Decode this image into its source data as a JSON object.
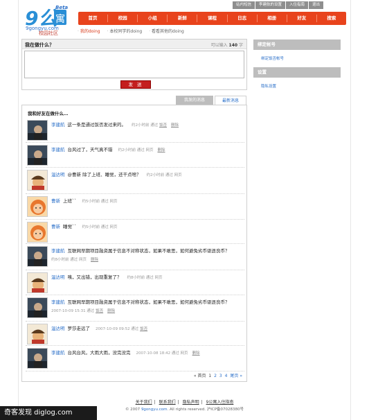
{
  "header": {
    "logo_main": "9公寓",
    "logo_beta": "Beta",
    "logo_domain": "9gongyu.com",
    "logo_sub": "校园社区",
    "top_links": [
      "站内短信",
      "李建航的设置",
      "入住指南",
      "退出"
    ],
    "nav": [
      "首页",
      "校园",
      "小组",
      "新鲜",
      "课程",
      "日志",
      "相册",
      "好友",
      "搜索"
    ],
    "subnav": [
      {
        "label": "我的doing",
        "active": true
      },
      {
        "label": "本校同学的doing",
        "active": false
      },
      {
        "label": "看看其他的doing",
        "active": false
      }
    ]
  },
  "status": {
    "title": "我在做什么？",
    "count_label": "可以输入",
    "count_value": "140",
    "count_unit": "字",
    "textarea_value": "",
    "send_label": "发 送"
  },
  "sidebar": {
    "bind_title": "绑定帐号",
    "bind_link": "绑定饭否帐号",
    "settings_title": "设置",
    "settings_link": "隐私设置"
  },
  "tabs": {
    "mine": "我发的消息",
    "latest": "最新消息"
  },
  "feed": {
    "title": "我和好友在做什么…",
    "items": [
      {
        "name": "李建航",
        "text": "这一条是通过饭否发过来的。",
        "meta": "约2小时前 通过",
        "via": "饭否",
        "del": "删除",
        "wrap": false,
        "avatar": "dark"
      },
      {
        "name": "李建航",
        "text": "台风过了，天气真不错",
        "meta": "约2小时前 通过 网页",
        "via": "",
        "del": "删除",
        "wrap": false,
        "avatar": "dark"
      },
      {
        "name": "温达明",
        "text": "@曹新  除了上班、睡觉，还干点啥？",
        "meta": "约2小时前 通过 网页",
        "via": "",
        "del": "",
        "wrap": false,
        "avatar": "hat"
      },
      {
        "name": "曹新",
        "text": "上班``",
        "meta": "约5小时前 通过 网页",
        "via": "",
        "del": "",
        "wrap": false,
        "avatar": "orange"
      },
      {
        "name": "曹新",
        "text": "睡觉``",
        "meta": "约5小时前 通过 网页",
        "via": "",
        "del": "",
        "wrap": false,
        "avatar": "orange"
      },
      {
        "name": "李建航",
        "text": "互联网早期项目融资属于信息不对称状态，如果不敢思，如何避免劣币驱逐良币？",
        "meta": "约8小时前 通过 网页",
        "via": "",
        "del": "删除",
        "wrap": true,
        "avatar": "dark"
      },
      {
        "name": "温达明",
        "text": "咦，又出错，出现重复了？",
        "meta": "约8小时前 通过 网页",
        "via": "",
        "del": "",
        "wrap": false,
        "avatar": "hat"
      },
      {
        "name": "李建航",
        "text": "互联网早期项目融资属于信息不对称状态，如果不敢思，如何避免劣币驱逐良币？",
        "meta": "2007-10-09 15:31 通过",
        "via": "饭否",
        "del": "删除",
        "wrap": true,
        "avatar": "dark"
      },
      {
        "name": "温达明",
        "text": "罗莎走远了",
        "meta": "2007-10-09 09:52 通过",
        "via": "饭否",
        "del": "",
        "wrap": false,
        "avatar": "hat"
      },
      {
        "name": "李建航",
        "text": "台风台风，大雨大雨，没完没完",
        "meta": "2007-10-08 18:42 通过 网页",
        "via": "",
        "del": "删除",
        "wrap": false,
        "avatar": "dark"
      }
    ]
  },
  "pager": {
    "first": "« 首页",
    "pages": [
      "1",
      "2",
      "3",
      "4"
    ],
    "last": "尾页 »"
  },
  "footer": {
    "links": [
      "关于我们",
      "联系我们",
      "隐私声明",
      "9公寓入住指南"
    ],
    "copy_prefix": "© 2007",
    "copy_brand": "9gongyu.com",
    "copy_suffix": ". All rights reserved. 沪ICP备07028380号"
  },
  "watermark": "奇客发现 diglog.com",
  "colors": {
    "nav_bg": "#e8431c",
    "send_btn": "#c41e1e",
    "link": "#2a6fc9",
    "side_head": "#bdbdbd"
  }
}
